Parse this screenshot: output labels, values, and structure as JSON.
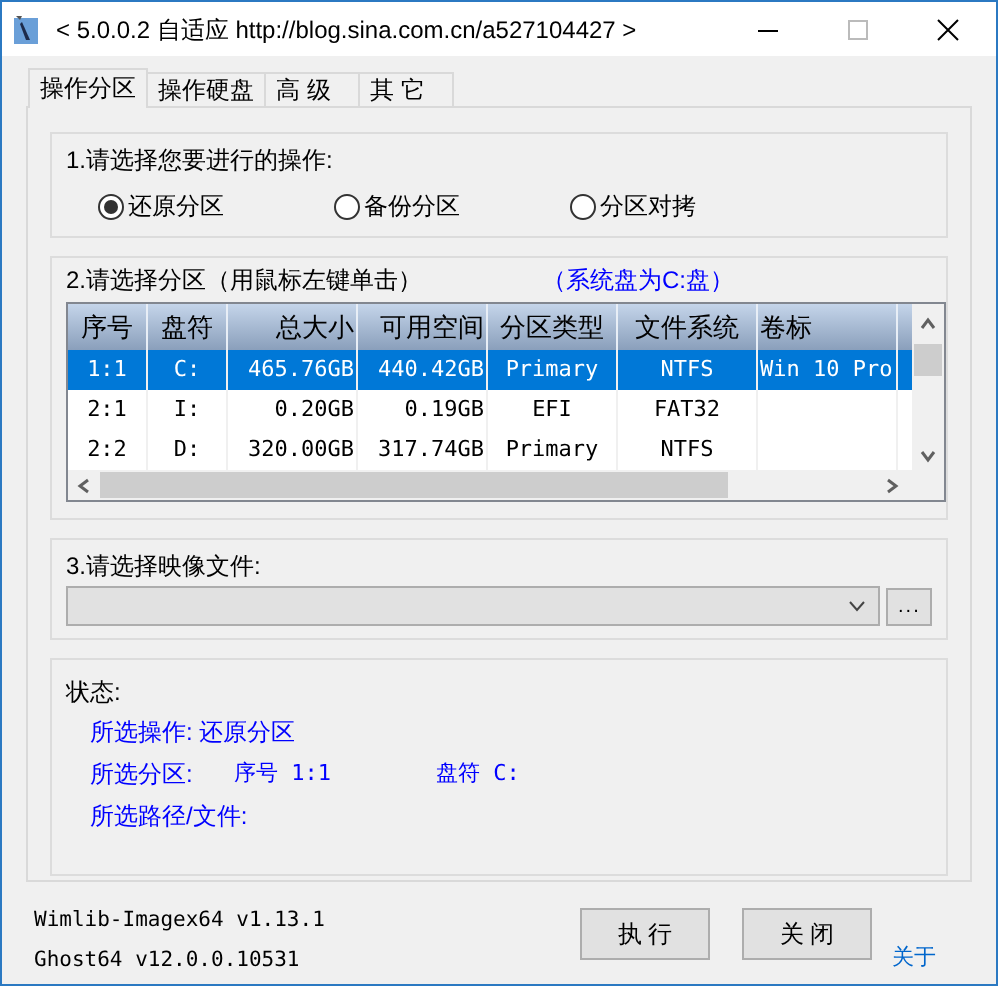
{
  "window": {
    "title": "< 5.0.0.2 自适应 http://blog.sina.com.cn/a527104427 >"
  },
  "tabs": [
    {
      "label": "操作分区",
      "selected": true
    },
    {
      "label": "操作硬盘",
      "selected": false
    },
    {
      "label": "高 级",
      "selected": false
    },
    {
      "label": "其 它",
      "selected": false
    }
  ],
  "operation": {
    "label": "1.请选择您要进行的操作:",
    "options": [
      {
        "label": "还原分区",
        "selected": true
      },
      {
        "label": "备份分区",
        "selected": false
      },
      {
        "label": "分区对拷",
        "selected": false
      }
    ]
  },
  "partition": {
    "label": "2.请选择分区（用鼠标左键单击）",
    "note": "（系统盘为C:盘）",
    "columns": [
      "序号",
      "盘符",
      "总大小",
      "可用空间",
      "分区类型",
      "文件系统",
      "卷标"
    ],
    "rows": [
      {
        "cells": [
          "1:1",
          "C:",
          "465.76GB",
          "440.42GB",
          "Primary",
          "NTFS",
          "Win 10 Pro"
        ],
        "selected": true
      },
      {
        "cells": [
          "2:1",
          "I:",
          "0.20GB",
          "0.19GB",
          "EFI",
          "FAT32"
        ],
        "selected": false
      },
      {
        "cells": [
          "2:2",
          "D:",
          "320.00GB",
          "317.74GB",
          "Primary",
          "NTFS"
        ],
        "selected": false
      }
    ]
  },
  "image_file": {
    "label": "3.请选择映像文件:",
    "browse_button": "..."
  },
  "status": {
    "title": "状态:",
    "operation": "所选操作: 还原分区",
    "partition_label": "所选分区:",
    "partition_number": "序号 1:1",
    "drive": "盘符 C:",
    "path": "所选路径/文件:"
  },
  "versions": [
    "Wimlib-Imagex64 v1.13.1",
    "Ghost64 v12.0.0.10531"
  ],
  "buttons": [
    "执 行",
    "关 闭"
  ],
  "about_link": "关于"
}
